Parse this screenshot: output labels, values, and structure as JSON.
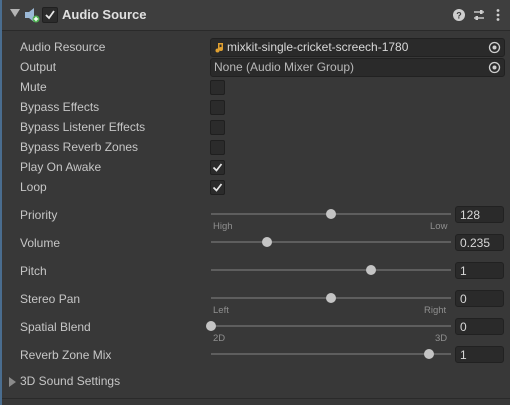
{
  "header": {
    "title": "Audio Source",
    "enabled": true,
    "icons": [
      "audio-source-icon",
      "help-icon",
      "preset-icon",
      "more-options-icon"
    ]
  },
  "properties": {
    "audio_resource": {
      "label": "Audio Resource",
      "value": "mixkit-single-cricket-screech-1780",
      "icon": "audio-clip-icon"
    },
    "output": {
      "label": "Output",
      "value": "None (Audio Mixer Group)"
    },
    "mute": {
      "label": "Mute",
      "checked": false
    },
    "bypass_effects": {
      "label": "Bypass Effects",
      "checked": false
    },
    "bypass_listener_effects": {
      "label": "Bypass Listener Effects",
      "checked": false
    },
    "bypass_reverb_zones": {
      "label": "Bypass Reverb Zones",
      "checked": false
    },
    "play_on_awake": {
      "label": "Play On Awake",
      "checked": true
    },
    "loop": {
      "label": "Loop",
      "checked": true
    },
    "priority": {
      "label": "Priority",
      "value": "128",
      "fraction": 0.5,
      "min_label": "High",
      "max_label": "Low"
    },
    "volume": {
      "label": "Volume",
      "value": "0.235",
      "fraction": 0.235
    },
    "pitch": {
      "label": "Pitch",
      "value": "1",
      "fraction": 0.667
    },
    "stereo_pan": {
      "label": "Stereo Pan",
      "value": "0",
      "fraction": 0.5,
      "min_label": "Left",
      "max_label": "Right"
    },
    "spatial_blend": {
      "label": "Spatial Blend",
      "value": "0",
      "fraction": 0.0,
      "min_label": "2D",
      "max_label": "3D"
    },
    "reverb_zone_mix": {
      "label": "Reverb Zone Mix",
      "value": "1",
      "fraction": 0.909
    }
  },
  "footer": {
    "label": "3D Sound Settings",
    "expanded": false
  },
  "colors": {
    "background": "#383838",
    "header": "#3e3e3e",
    "field": "#2a2a2a",
    "accent_bar": "#4a6d8f",
    "clip_icon": "#e0a030"
  }
}
